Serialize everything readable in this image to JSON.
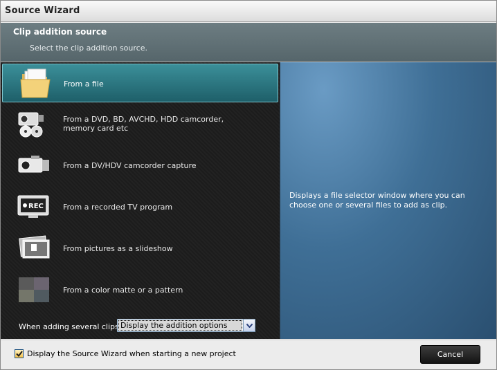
{
  "window": {
    "title": "Source Wizard"
  },
  "header": {
    "title": "Clip addition source",
    "subtitle": "Select the clip addition source."
  },
  "sources": [
    {
      "label": "From a file",
      "icon": "folder-icon",
      "selected": true
    },
    {
      "label": "From a DVD, BD, AVCHD, HDD camcorder, memory card etc",
      "icon": "camcorder-disc-icon",
      "selected": false
    },
    {
      "label": "From a DV/HDV camcorder capture",
      "icon": "dv-camcorder-icon",
      "selected": false
    },
    {
      "label": "From a recorded TV program",
      "icon": "tv-rec-icon",
      "selected": false
    },
    {
      "label": "From pictures as a slideshow",
      "icon": "slideshow-icon",
      "selected": false
    },
    {
      "label": "From a color matte or a pattern",
      "icon": "color-matte-icon",
      "selected": false
    }
  ],
  "description": "Displays a file selector window where you can choose one or several files to add as clip.",
  "multi_clips": {
    "label": "When adding several clips:",
    "selected": "Display the addition options"
  },
  "footer": {
    "checkbox_label": "Display the Source Wizard when starting a new project",
    "checkbox_checked": true,
    "cancel_label": "Cancel"
  },
  "colors": {
    "accent": "#2e7f89",
    "panel_blue": "#4d7ea8",
    "list_background": "#1e1e1e"
  }
}
